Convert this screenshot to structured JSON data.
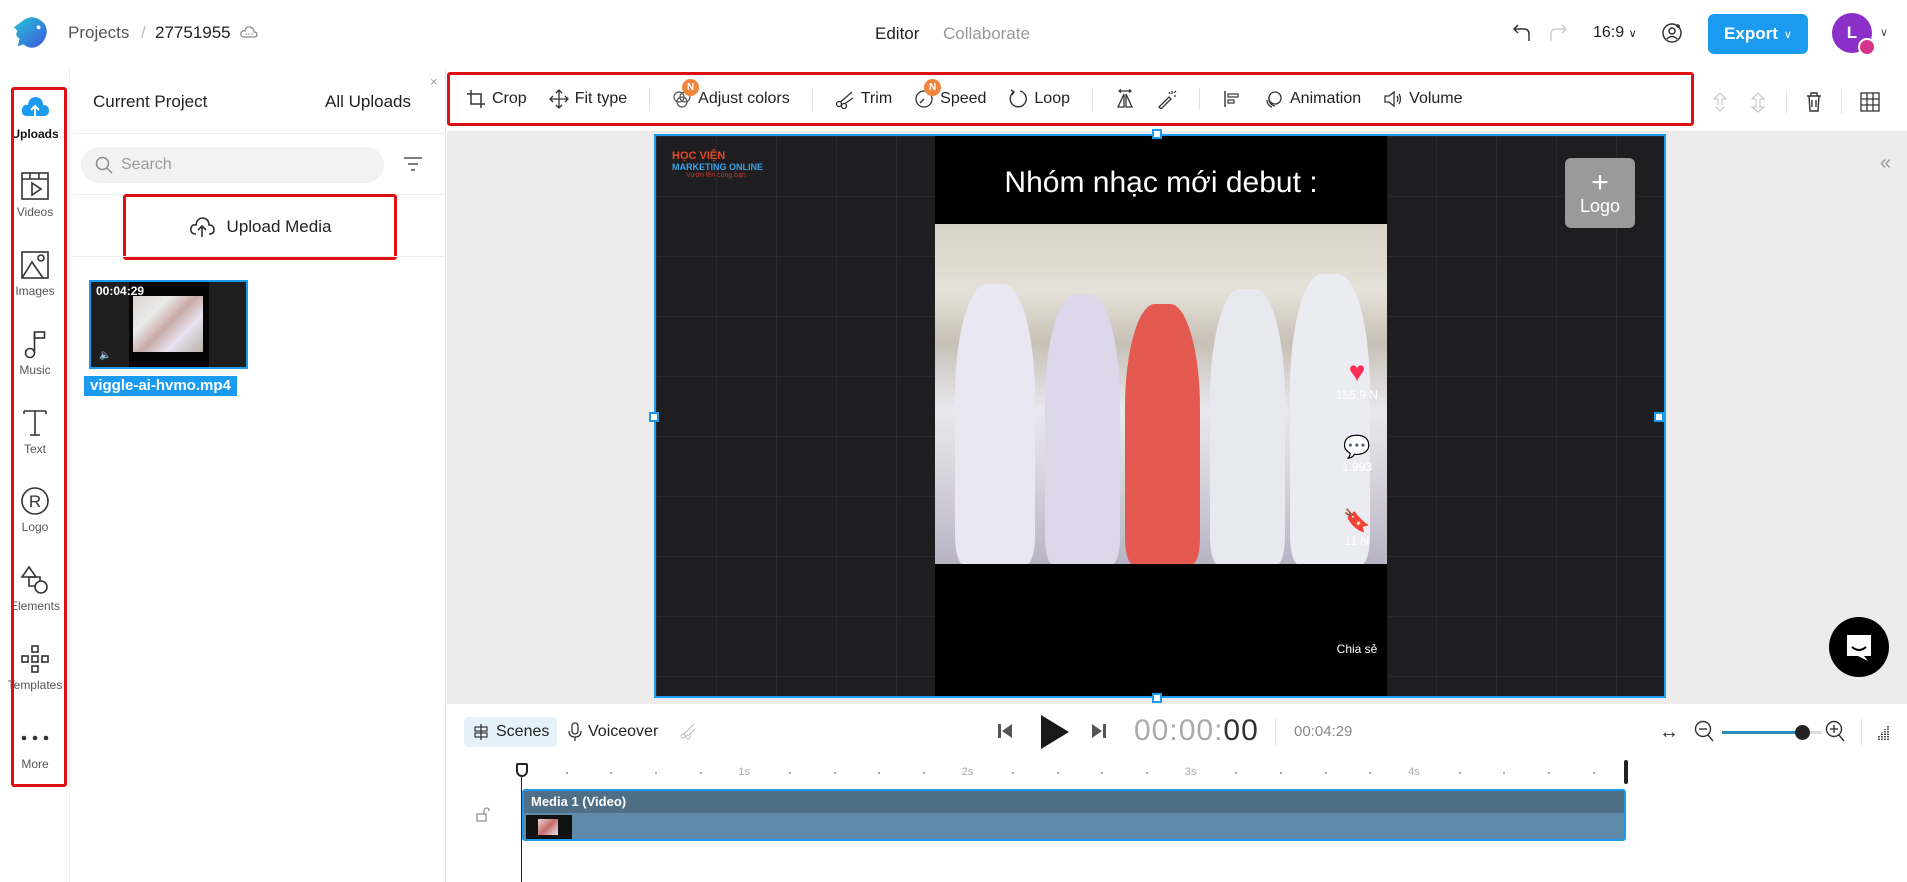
{
  "header": {
    "breadcrumb_projects": "Projects",
    "breadcrumb_separator": "/",
    "project_id": "27751955",
    "tabs": [
      {
        "label": "Editor",
        "active": true
      },
      {
        "label": "Collaborate",
        "active": false
      }
    ],
    "aspect_ratio": "16:9",
    "export_label": "Export",
    "avatar_initial": "L",
    "accent_color": "#1a9bf0"
  },
  "rail": {
    "items": [
      {
        "label": "Uploads",
        "icon": "cloud-upload-icon",
        "active": true
      },
      {
        "label": "Videos",
        "icon": "video-icon"
      },
      {
        "label": "Images",
        "icon": "image-icon"
      },
      {
        "label": "Music",
        "icon": "music-note-icon"
      },
      {
        "label": "Text",
        "icon": "text-icon"
      },
      {
        "label": "Logo",
        "icon": "registered-icon"
      },
      {
        "label": "Elements",
        "icon": "shapes-icon"
      },
      {
        "label": "Templates",
        "icon": "templates-icon"
      },
      {
        "label": "More",
        "icon": "more-dots-icon"
      }
    ]
  },
  "panel": {
    "close_label": "×",
    "tab_current": "Current Project",
    "tab_all": "All Uploads",
    "search_placeholder": "Search",
    "upload_label": "Upload Media",
    "media": [
      {
        "duration": "00:04:29",
        "filename": "viggle-ai-hvmo.mp4"
      }
    ]
  },
  "toolbar": {
    "tools": [
      {
        "label": "Crop",
        "icon": "crop-icon"
      },
      {
        "label": "Fit type",
        "icon": "fit-arrows-icon"
      },
      {
        "label": "Adjust colors",
        "icon": "color-circles-icon",
        "badge": "N"
      },
      {
        "label": "Trim",
        "icon": "scissors-icon"
      },
      {
        "label": "Speed",
        "icon": "speedometer-icon",
        "badge": "N"
      },
      {
        "label": "Loop",
        "icon": "loop-icon"
      },
      {
        "label": "Animation",
        "icon": "animation-icon"
      },
      {
        "label": "Volume",
        "icon": "volume-icon"
      }
    ]
  },
  "canvas": {
    "video_title": "Nhóm nhạc mới debut :",
    "watermark_brand": "HỌC VIỆN",
    "watermark_sub": "MARKETING ONLINE",
    "watermark_tag": "Vươn lên cùng bạn",
    "logo_placeholder_label": "Logo",
    "stats": {
      "likes": "155,9 N",
      "comments": "1.993",
      "saves": "11 N",
      "share": "Chia sẻ"
    }
  },
  "playback": {
    "scenes_label": "Scenes",
    "voiceover_label": "Voiceover",
    "timecode_main": "00:00:",
    "timecode_frames": "00",
    "duration": "00:04:29",
    "zoom_level_fraction": 0.8
  },
  "timeline": {
    "ruler_labels": [
      "1s",
      "2s",
      "3s",
      "4s"
    ],
    "total_seconds": 4.95,
    "clip_label": "Media 1 (Video)"
  }
}
